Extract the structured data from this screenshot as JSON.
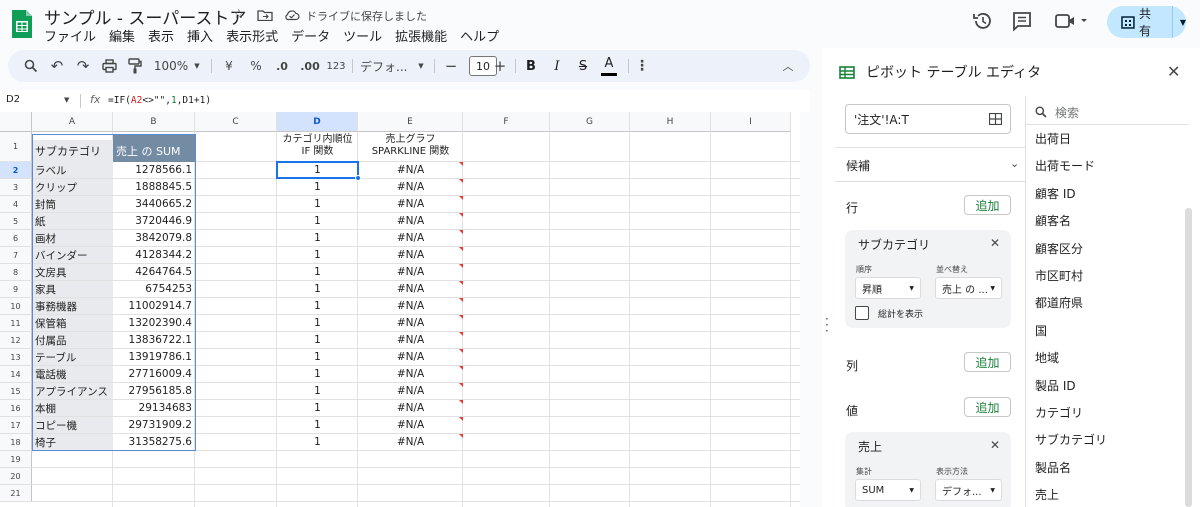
{
  "app": {
    "doc_title": "サンプル - スーパーストア",
    "saved_status": "ドライブに保存しました",
    "menu": [
      "ファイル",
      "編集",
      "表示",
      "挿入",
      "表示形式",
      "データ",
      "ツール",
      "拡張機能",
      "ヘルプ"
    ],
    "share_label": "共有"
  },
  "toolbar": {
    "zoom": "100%",
    "currency": "¥",
    "percent": "%",
    "dec_decrease": ".0",
    "dec_increase": ".00",
    "number_format": "123",
    "font": "デフォ...",
    "font_size": "10",
    "bold": "B",
    "italic": "I",
    "text_color": "A"
  },
  "formula_bar": {
    "name_box": "D2",
    "fx": "fx",
    "formula_pre": "=IF(",
    "formula_ref1": "A2",
    "formula_mid": "<>\"\",",
    "formula_num": "1",
    "formula_sep": ",",
    "formula_ref2": "D1",
    "formula_end": "+1)"
  },
  "sheet": {
    "columns": [
      "A",
      "B",
      "C",
      "D",
      "E",
      "F",
      "G",
      "H",
      "I"
    ],
    "row_numbers": [
      "1",
      "2",
      "3",
      "4",
      "5",
      "6",
      "7",
      "8",
      "9",
      "10",
      "11",
      "12",
      "13",
      "14",
      "15",
      "16",
      "17",
      "18",
      "19",
      "20",
      "21"
    ],
    "header": {
      "a": "サブカテゴリ",
      "b": "売上 の SUM",
      "d_line1": "カテゴリ内順位",
      "d_line2": "IF 関数",
      "e_line1": "売上グラフ",
      "e_line2": "SPARKLINE 関数"
    },
    "rows": [
      {
        "a": "ラベル",
        "b": "1278566.1",
        "d": "1",
        "e": "#N/A"
      },
      {
        "a": "クリップ",
        "b": "1888845.5",
        "d": "1",
        "e": "#N/A"
      },
      {
        "a": "封筒",
        "b": "3440665.2",
        "d": "1",
        "e": "#N/A"
      },
      {
        "a": "紙",
        "b": "3720446.9",
        "d": "1",
        "e": "#N/A"
      },
      {
        "a": "画材",
        "b": "3842079.8",
        "d": "1",
        "e": "#N/A"
      },
      {
        "a": "バインダー",
        "b": "4128344.2",
        "d": "1",
        "e": "#N/A"
      },
      {
        "a": "文房具",
        "b": "4264764.5",
        "d": "1",
        "e": "#N/A"
      },
      {
        "a": "家具",
        "b": "6754253",
        "d": "1",
        "e": "#N/A"
      },
      {
        "a": "事務機器",
        "b": "11002914.7",
        "d": "1",
        "e": "#N/A"
      },
      {
        "a": "保管箱",
        "b": "13202390.4",
        "d": "1",
        "e": "#N/A"
      },
      {
        "a": "付属品",
        "b": "13836722.1",
        "d": "1",
        "e": "#N/A"
      },
      {
        "a": "テーブル",
        "b": "13919786.1",
        "d": "1",
        "e": "#N/A"
      },
      {
        "a": "電話機",
        "b": "27716009.4",
        "d": "1",
        "e": "#N/A"
      },
      {
        "a": "アプライアンス",
        "b": "27956185.8",
        "d": "1",
        "e": "#N/A"
      },
      {
        "a": "本棚",
        "b": "29134683",
        "d": "1",
        "e": "#N/A"
      },
      {
        "a": "コピー機",
        "b": "29731909.2",
        "d": "1",
        "e": "#N/A"
      },
      {
        "a": "椅子",
        "b": "31358275.6",
        "d": "1",
        "e": "#N/A"
      }
    ]
  },
  "pivot_editor": {
    "title": "ピボット テーブル エディタ",
    "range": "'注文'!A:T",
    "suggestions": "候補",
    "rows_label": "行",
    "columns_label": "列",
    "values_label": "値",
    "add_label": "追加",
    "row_card": {
      "title": "サブカテゴリ",
      "order_label": "順序",
      "order_value": "昇順",
      "sort_label": "並べ替え",
      "sort_value": "売上 の ...",
      "show_totals": "総計を表示"
    },
    "value_card": {
      "title": "売上",
      "summarize_label": "集計",
      "summarize_value": "SUM",
      "display_label": "表示方法",
      "display_value": "デフォ..."
    },
    "search_placeholder": "検索",
    "fields": [
      "出荷日",
      "出荷モード",
      "顧客 ID",
      "顧客名",
      "顧客区分",
      "市区町村",
      "都道府県",
      "国",
      "地域",
      "製品 ID",
      "カテゴリ",
      "サブカテゴリ",
      "製品名",
      "売上"
    ]
  }
}
